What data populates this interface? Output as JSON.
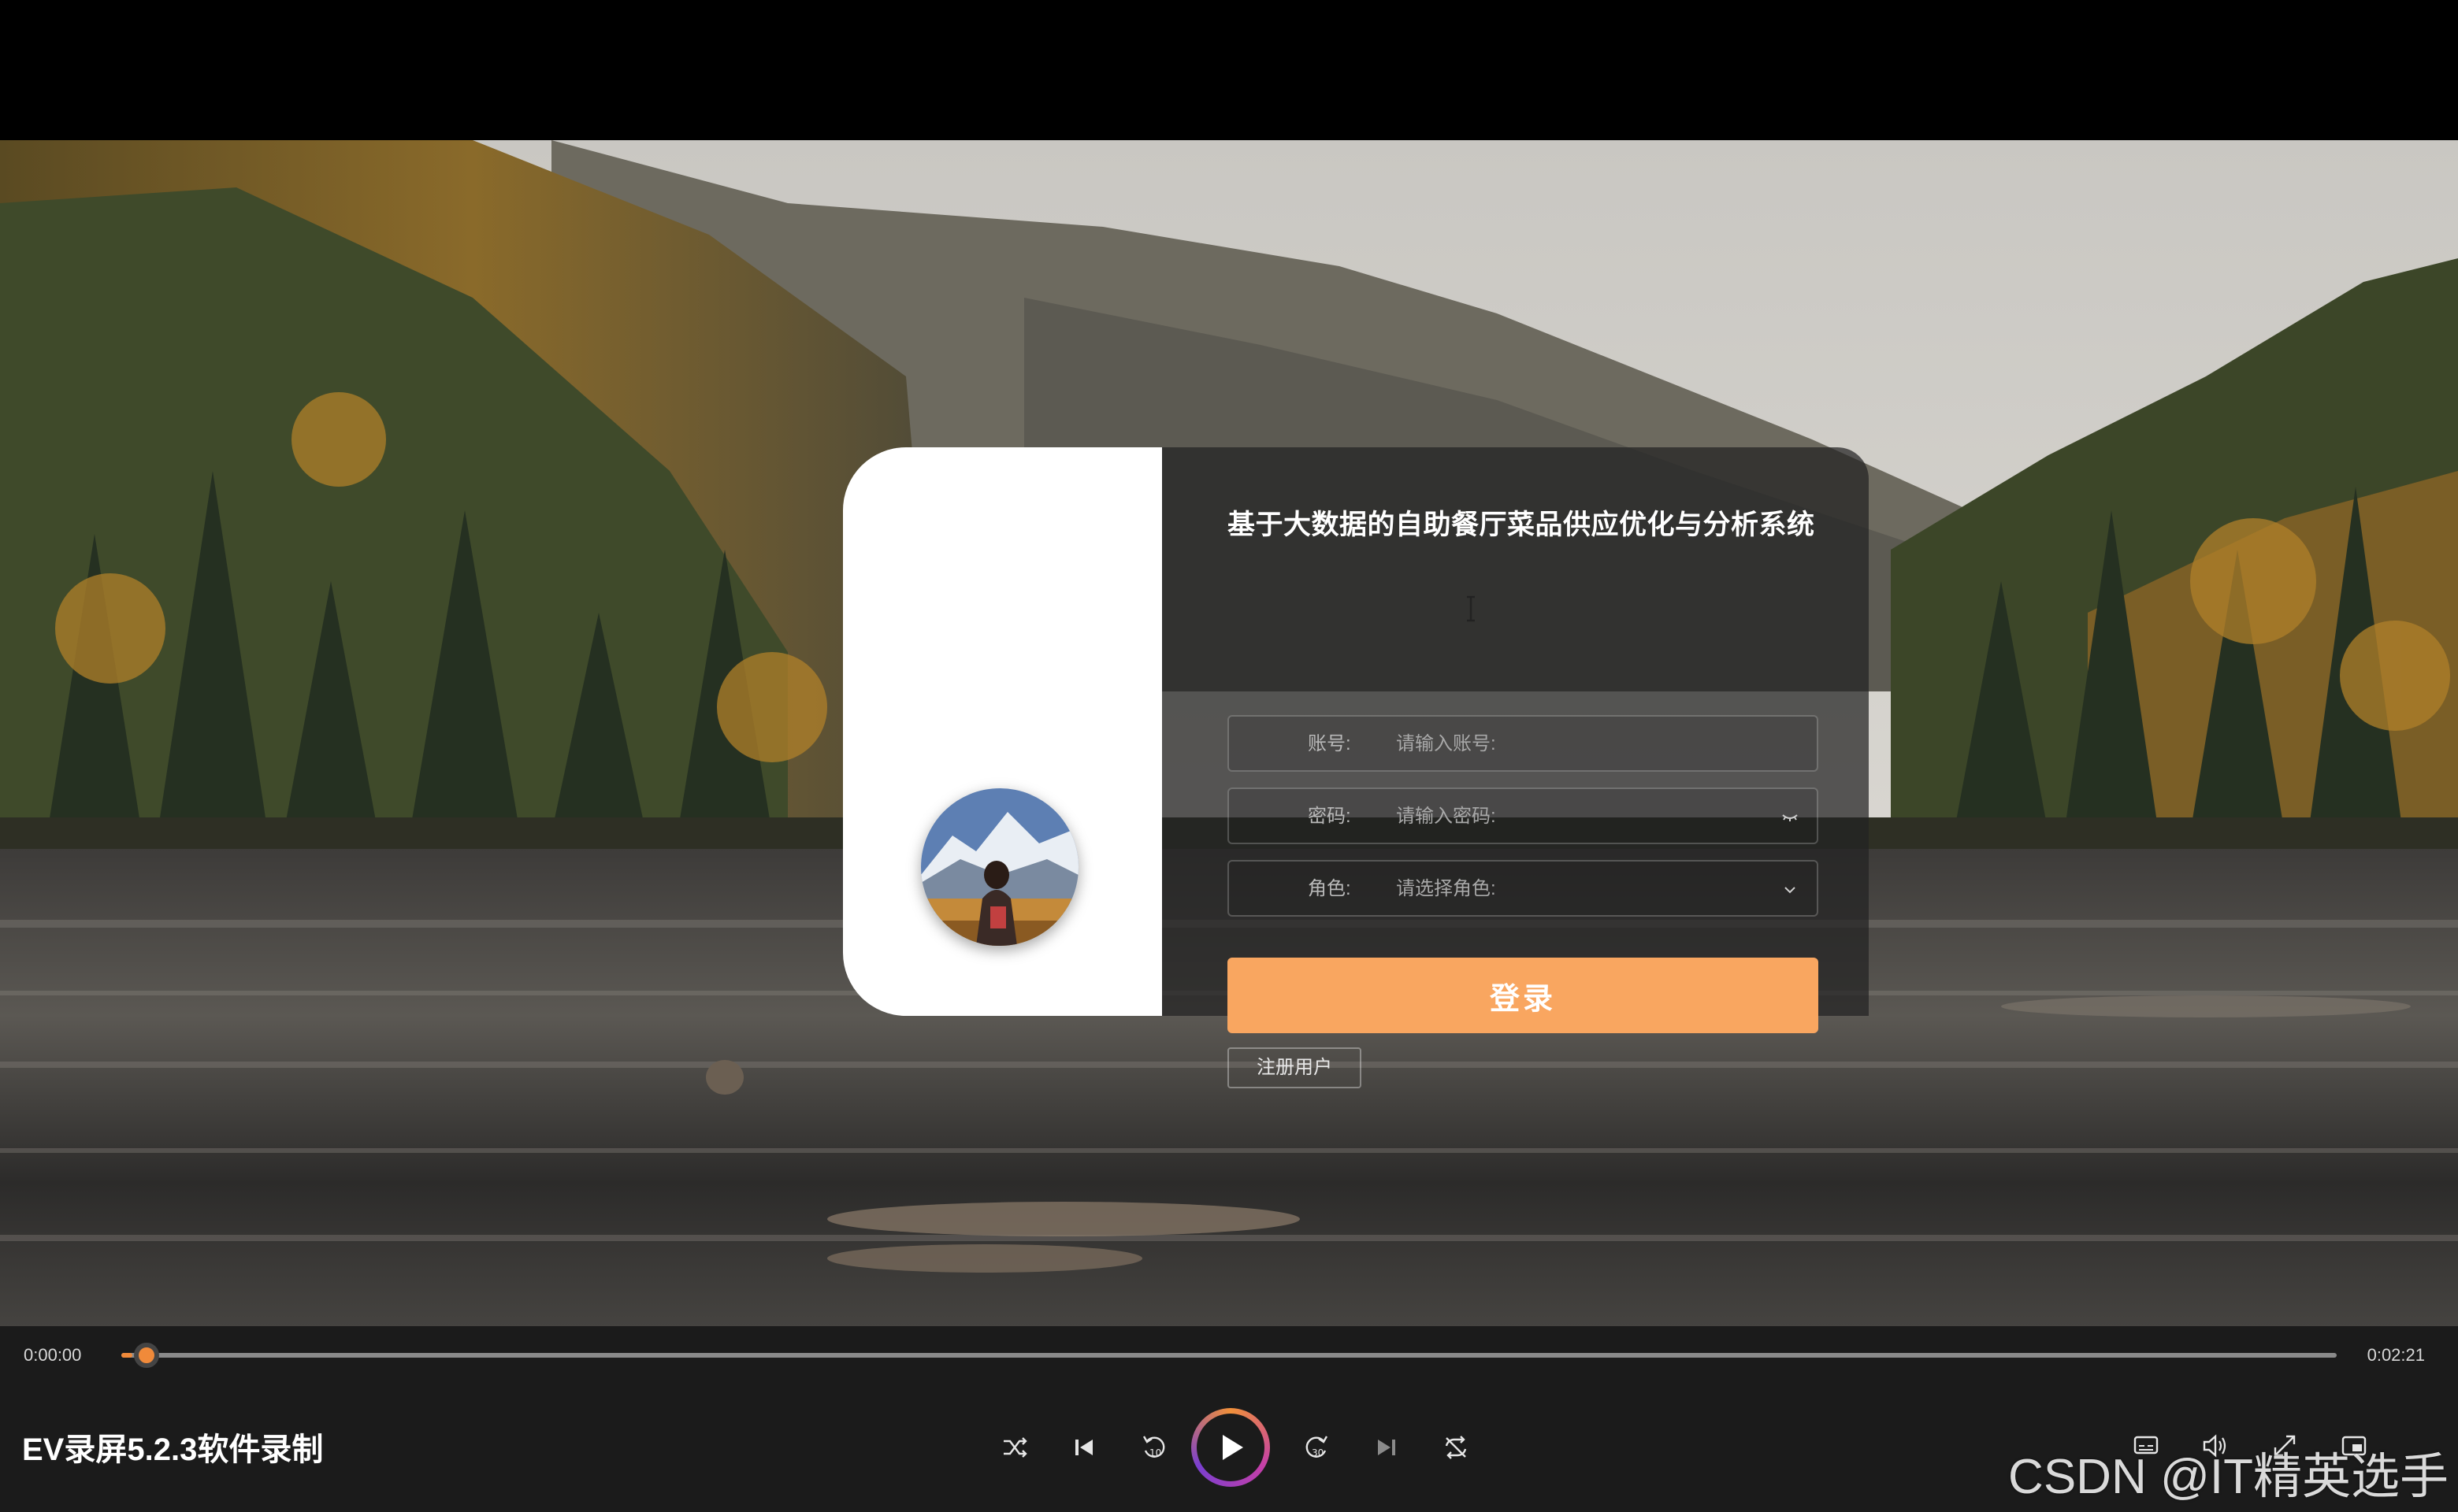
{
  "login": {
    "system_title": "基于大数据的自助餐厅菜品供应优化与分析系统",
    "account_label": "账号:",
    "account_placeholder": "请输入账号:",
    "password_label": "密码:",
    "password_placeholder": "请输入密码:",
    "role_label": "角色:",
    "role_placeholder": "请选择角色:",
    "login_button": "登录",
    "register_button": "注册用户"
  },
  "player": {
    "current_time": "0:00:00",
    "total_time": "0:02:21",
    "progress": 0.005,
    "video_title": "EV录屏5.2.3软件录制",
    "accent_color": "#f08a3a",
    "controls": [
      "shuffle-icon",
      "previous-icon",
      "rewind-10-icon",
      "play-icon",
      "forward-30-icon",
      "next-icon",
      "repeat-off-icon"
    ],
    "right_controls": [
      "subtitles-icon",
      "volume-icon",
      "fullscreen-icon",
      "miniplayer-icon"
    ]
  },
  "watermark": "CSDN @IT精英选手"
}
